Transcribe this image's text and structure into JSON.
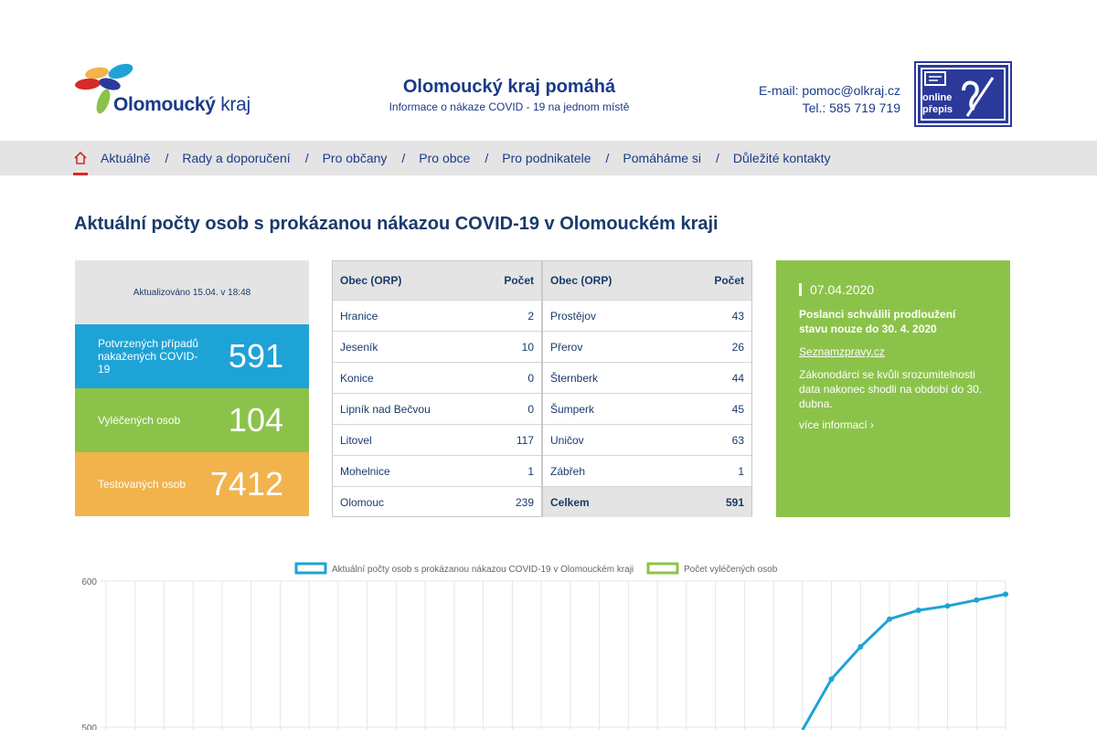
{
  "header": {
    "logo_text_bold": "Olomoucký",
    "logo_text_regular": " kraj",
    "title": "Olomoucký kraj pomáhá",
    "subtitle": "Informace o nákaze COVID - 19 na jednom místě",
    "email": "E-mail: pomoc@olkraj.cz",
    "phone": "Tel.: 585 719 719",
    "online_prepis_line1": "online",
    "online_prepis_line2": "přepis"
  },
  "nav": {
    "items": [
      "Aktuálně",
      "Rady a doporučení",
      "Pro občany",
      "Pro obce",
      "Pro podnikatele",
      "Pomáháme si",
      "Důležité kontakty"
    ],
    "separator": "/"
  },
  "page_title": "Aktuální počty osob s prokázanou nákazou COVID-19 v Olomouckém kraji",
  "stats": {
    "updated": "Aktualizováno 15.04. v 18:48",
    "confirmed_label": "Potvrzených případů nakažených COVID-19",
    "confirmed_value": "591",
    "cured_label": "Vyléčených osob",
    "cured_value": "104",
    "tested_label": "Testovaných osob",
    "tested_value": "7412"
  },
  "table_left": {
    "col1": "Obec (ORP)",
    "col2": "Počet",
    "rows": [
      {
        "name": "Hranice",
        "count": "2"
      },
      {
        "name": "Jeseník",
        "count": "10"
      },
      {
        "name": "Konice",
        "count": "0"
      },
      {
        "name": "Lipník nad Bečvou",
        "count": "0"
      },
      {
        "name": "Litovel",
        "count": "117"
      },
      {
        "name": "Mohelnice",
        "count": "1"
      },
      {
        "name": "Olomouc",
        "count": "239"
      }
    ]
  },
  "table_right": {
    "col1": "Obec (ORP)",
    "col2": "Počet",
    "rows": [
      {
        "name": "Prostějov",
        "count": "43"
      },
      {
        "name": "Přerov",
        "count": "26"
      },
      {
        "name": "Šternberk",
        "count": "44"
      },
      {
        "name": "Šumperk",
        "count": "45"
      },
      {
        "name": "Uničov",
        "count": "63"
      },
      {
        "name": "Zábřeh",
        "count": "1"
      }
    ],
    "total_label": "Celkem",
    "total_value": "591"
  },
  "news": {
    "date": "07.04.2020",
    "headline": "Poslanci schválili prodloužení stavu nouze do 30. 4. 2020",
    "source": "Seznamzpravy.cz",
    "body": "Zákonodárci se kvůli srozumitelnosti data nakonec shodli na období do 30. dubna.",
    "more": "více informací"
  },
  "colors": {
    "brand_blue": "#1a3a8a",
    "confirmed": "#1ea3d6",
    "cured": "#8bc34a",
    "tested": "#f2b34d",
    "nav_bg": "#e4e4e4",
    "nav_active": "#d32a2a"
  },
  "chart_data": {
    "type": "line",
    "series": [
      {
        "name": "Aktuální počty osob s prokázanou nákazou COVID-19 v Olomouckém kraji",
        "color": "#1ea3d6",
        "values": [
          null,
          null,
          null,
          null,
          null,
          null,
          null,
          null,
          null,
          null,
          null,
          null,
          null,
          null,
          null,
          null,
          null,
          null,
          null,
          null,
          null,
          null,
          null,
          null,
          490,
          533,
          555,
          574,
          580,
          583,
          587,
          591
        ]
      },
      {
        "name": "Počet vyléčených osob",
        "color": "#8bc34a",
        "values": []
      }
    ],
    "y_ticks": [
      500,
      600
    ],
    "x_count": 32,
    "ylim": [
      500,
      600
    ],
    "grid": true,
    "legend": "top"
  }
}
